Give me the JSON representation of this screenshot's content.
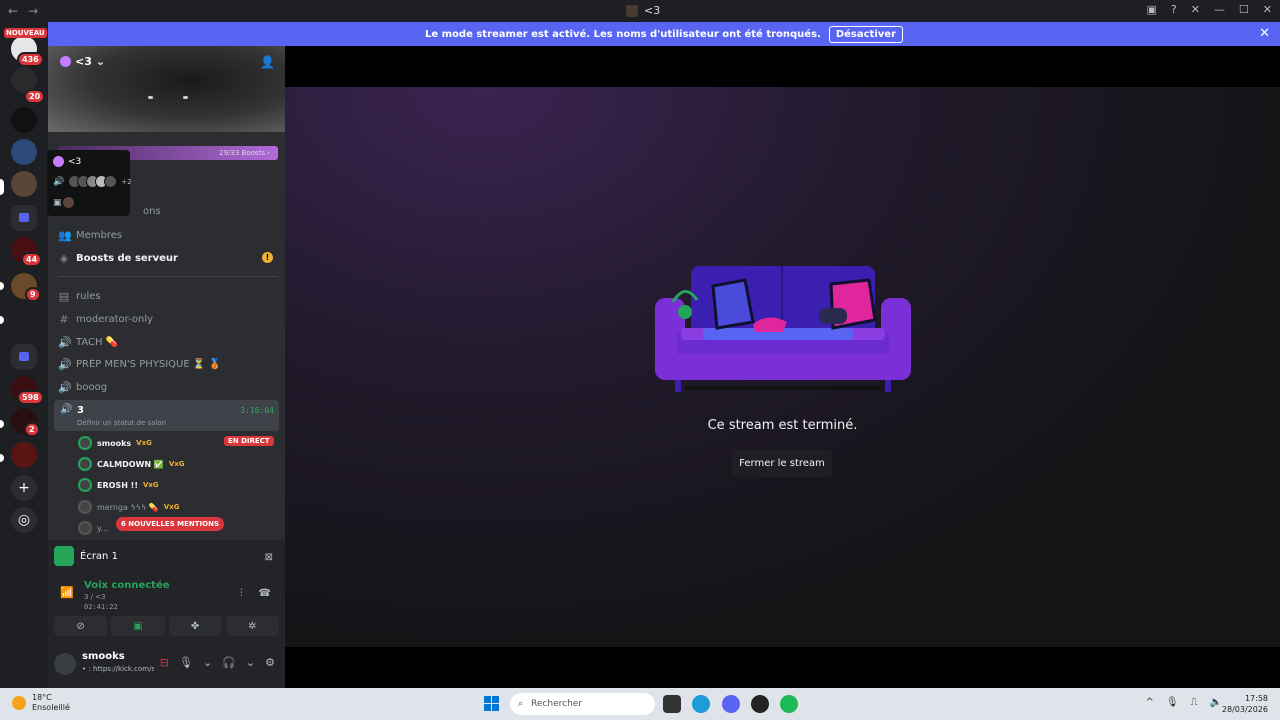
{
  "window": {
    "title": "<3"
  },
  "banner": {
    "text": "Le mode streamer est activé. Les noms d'utilisateur ont été tronqués.",
    "button": "Désactiver"
  },
  "rail": {
    "nouveau": "NOUVEAU",
    "badges": [
      "436",
      "20",
      "44",
      "9",
      "598",
      "2"
    ]
  },
  "server": {
    "name": "<3",
    "boosts": "29/33 Boosts"
  },
  "popup": {
    "name": "<3",
    "extra": "+2"
  },
  "channels": {
    "partial_label": "ons",
    "members": "Membres",
    "boosts": "Boosts de serveur",
    "rules": "rules",
    "moderator": "moderator-only",
    "tach": "TACH 💊",
    "prep": "PRÉP MEN'S PHYSIQUE ⏳ 🥉",
    "booog": "booog",
    "voice_name": "3",
    "voice_time": "3:16:04",
    "voice_status": "Définir un statut de salon"
  },
  "voice_users": [
    {
      "name": "smooks",
      "tag": "VxG",
      "live": "EN DIRECT"
    },
    {
      "name": "CALMDOWN ✅",
      "tag": "VxG"
    },
    {
      "name": "EROSH !!",
      "tag": "VxG"
    },
    {
      "name": "mernga ϟϟϟ 💊",
      "tag": "VxG"
    },
    {
      "name": "y..."
    }
  ],
  "mentions": "6 NOUVELLES MENTIONS",
  "panel": {
    "screen": "Écran 1",
    "voice_connected": "Voix connectée",
    "voice_location": "3 / <3",
    "voice_duration": "02:41:22"
  },
  "user": {
    "name": "smooks",
    "status": "• : https://kick.com/smooks"
  },
  "stage": {
    "ended": "Ce stream est terminé.",
    "close": "Fermer le stream"
  },
  "taskbar": {
    "temp": "18°C",
    "weather": "Ensoleillé",
    "search": "Rechercher",
    "time": "17:58",
    "date": "28/03/2026"
  }
}
